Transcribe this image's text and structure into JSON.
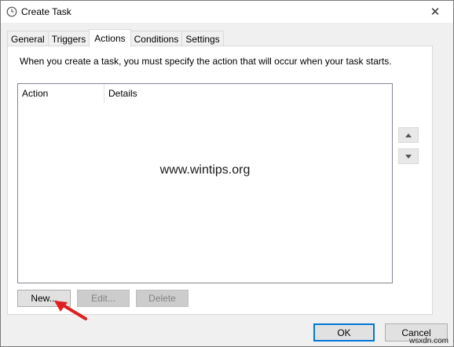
{
  "window": {
    "title": "Create Task",
    "close_glyph": "✕"
  },
  "tabs": [
    {
      "label": "General",
      "active": false
    },
    {
      "label": "Triggers",
      "active": false
    },
    {
      "label": "Actions",
      "active": true
    },
    {
      "label": "Conditions",
      "active": false
    },
    {
      "label": "Settings",
      "active": false
    }
  ],
  "actions_panel": {
    "description": "When you create a task, you must specify the action that will occur when your task starts.",
    "columns": [
      "Action",
      "Details"
    ],
    "rows": [],
    "watermark": "www.wintips.org",
    "new_label": "New...",
    "edit_label": "Edit...",
    "delete_label": "Delete"
  },
  "footer": {
    "ok_label": "OK",
    "cancel_label": "Cancel",
    "corner_watermark": "wsxdn.com"
  },
  "icons": {
    "title": "clock-icon",
    "move_up": "triangle-up-icon",
    "move_down": "triangle-down-icon",
    "annotation": "red-arrow-icon"
  },
  "colors": {
    "window_bg": "#f0f0f0",
    "panel_bg": "#ffffff",
    "primary_border": "#0078d7",
    "annotation_arrow": "#e02020"
  }
}
